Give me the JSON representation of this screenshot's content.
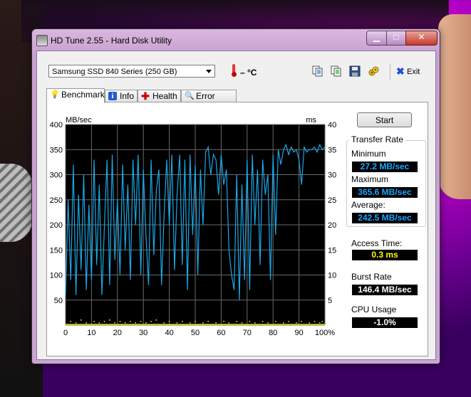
{
  "window": {
    "title": "HD Tune 2.55 - Hard Disk Utility"
  },
  "toolbar": {
    "drive": "Samsung SSD 840 Series (250 GB)",
    "temperature": "– °C",
    "exit_label": "Exit"
  },
  "tabs": [
    {
      "label": "Benchmark",
      "icon": "lightbulb-icon"
    },
    {
      "label": "Info",
      "icon": "info-icon"
    },
    {
      "label": "Health",
      "icon": "health-plus-icon"
    },
    {
      "label": "Error Scan",
      "icon": "magnifier-icon"
    }
  ],
  "buttons": {
    "start": "Start"
  },
  "stats": {
    "transfer_rate_title": "Transfer Rate",
    "minimum_label": "Minimum",
    "minimum_value": "27.2 MB/sec",
    "maximum_label": "Maximum",
    "maximum_value": "365.6 MB/sec",
    "average_label": "Average:",
    "average_value": "242.5 MB/sec",
    "access_time_label": "Access Time:",
    "access_time_value": "0.3 ms",
    "burst_rate_label": "Burst Rate",
    "burst_rate_value": "146.4 MB/sec",
    "cpu_usage_label": "CPU Usage",
    "cpu_usage_value": "-1.0%"
  },
  "colors": {
    "transfer_line": "#1aa7e6",
    "access_dots": "#e8e800",
    "value_blue": "#1aa7ff",
    "value_yellow": "#ffff00",
    "value_white": "#ffffff"
  },
  "chart_data": {
    "type": "line",
    "ylabel_left": "MB/sec",
    "ylabel_right": "ms",
    "yticks_left": [
      400,
      350,
      300,
      250,
      200,
      150,
      100,
      50
    ],
    "yticks_right": [
      40,
      35,
      30,
      25,
      20,
      15,
      10,
      5
    ],
    "xticks": [
      "0",
      "10",
      "20",
      "30",
      "40",
      "50",
      "60",
      "70",
      "80",
      "90",
      "100%"
    ],
    "ylim": [
      0,
      400
    ],
    "xlim": [
      0,
      100
    ],
    "grid": true,
    "series": [
      {
        "values": [
          [
            0,
            60
          ],
          [
            1,
            250
          ],
          [
            2,
            90
          ],
          [
            3,
            320
          ],
          [
            4,
            60
          ],
          [
            5,
            260
          ],
          [
            6,
            110
          ],
          [
            7,
            300
          ],
          [
            8,
            70
          ],
          [
            9,
            240
          ],
          [
            10,
            90
          ],
          [
            11,
            330
          ],
          [
            12,
            120
          ],
          [
            13,
            280
          ],
          [
            14,
            60
          ],
          [
            15,
            200
          ],
          [
            16,
            330
          ],
          [
            17,
            80
          ],
          [
            18,
            340
          ],
          [
            19,
            130
          ],
          [
            20,
            250
          ],
          [
            21,
            100
          ],
          [
            22,
            320
          ],
          [
            23,
            150
          ],
          [
            24,
            280
          ],
          [
            25,
            90
          ],
          [
            26,
            330
          ],
          [
            27,
            200
          ],
          [
            28,
            340
          ],
          [
            29,
            100
          ],
          [
            30,
            310
          ],
          [
            31,
            180
          ],
          [
            32,
            80
          ],
          [
            33,
            330
          ],
          [
            34,
            140
          ],
          [
            35,
            270
          ],
          [
            36,
            310
          ],
          [
            37,
            80
          ],
          [
            38,
            220
          ],
          [
            39,
            330
          ],
          [
            40,
            200
          ],
          [
            41,
            340
          ],
          [
            42,
            110
          ],
          [
            43,
            260
          ],
          [
            44,
            340
          ],
          [
            45,
            120
          ],
          [
            46,
            330
          ],
          [
            47,
            70
          ],
          [
            48,
            340
          ],
          [
            49,
            180
          ],
          [
            50,
            320
          ],
          [
            51,
            100
          ],
          [
            52,
            310
          ],
          [
            53,
            200
          ],
          [
            54,
            345
          ],
          [
            55,
            355
          ],
          [
            56,
            300
          ],
          [
            57,
            340
          ],
          [
            58,
            330
          ],
          [
            59,
            260
          ],
          [
            60,
            340
          ],
          [
            61,
            280
          ],
          [
            62,
            310
          ],
          [
            63,
            150
          ],
          [
            64,
            100
          ],
          [
            65,
            70
          ],
          [
            66,
            300
          ],
          [
            67,
            50
          ],
          [
            68,
            280
          ],
          [
            69,
            90
          ],
          [
            70,
            330
          ],
          [
            71,
            70
          ],
          [
            72,
            340
          ],
          [
            73,
            200
          ],
          [
            74,
            310
          ],
          [
            75,
            120
          ],
          [
            76,
            330
          ],
          [
            77,
            260
          ],
          [
            78,
            300
          ],
          [
            79,
            90
          ],
          [
            80,
            340
          ],
          [
            81,
            180
          ],
          [
            82,
            350
          ],
          [
            83,
            320
          ],
          [
            84,
            350
          ],
          [
            85,
            360
          ],
          [
            86,
            340
          ],
          [
            87,
            355
          ],
          [
            88,
            345
          ],
          [
            89,
            350
          ],
          [
            90,
            330
          ],
          [
            91,
            280
          ],
          [
            92,
            355
          ],
          [
            93,
            345
          ],
          [
            94,
            350
          ],
          [
            95,
            350
          ],
          [
            96,
            355
          ],
          [
            97,
            345
          ],
          [
            98,
            360
          ],
          [
            99,
            350
          ],
          [
            100,
            355
          ]
        ]
      }
    ],
    "access_points": [
      [
        2,
        2
      ],
      [
        4,
        1
      ],
      [
        6,
        3
      ],
      [
        8,
        1
      ],
      [
        11,
        2
      ],
      [
        13,
        1
      ],
      [
        15,
        2
      ],
      [
        17,
        3
      ],
      [
        19,
        1
      ],
      [
        21,
        2
      ],
      [
        23,
        1
      ],
      [
        25,
        2
      ],
      [
        27,
        1
      ],
      [
        29,
        2
      ],
      [
        31,
        1
      ],
      [
        33,
        2
      ],
      [
        35,
        3
      ],
      [
        38,
        1
      ],
      [
        40,
        2
      ],
      [
        43,
        1
      ],
      [
        45,
        2
      ],
      [
        48,
        1
      ],
      [
        50,
        2
      ],
      [
        53,
        1
      ],
      [
        55,
        2
      ],
      [
        58,
        1
      ],
      [
        61,
        2
      ],
      [
        63,
        1
      ],
      [
        66,
        2
      ],
      [
        68,
        1
      ],
      [
        71,
        2
      ],
      [
        73,
        1
      ],
      [
        76,
        2
      ],
      [
        78,
        1
      ],
      [
        81,
        2
      ],
      [
        84,
        1
      ],
      [
        86,
        2
      ],
      [
        89,
        1
      ],
      [
        91,
        2
      ],
      [
        94,
        1
      ],
      [
        96,
        2
      ],
      [
        98,
        1
      ],
      [
        99,
        2
      ]
    ]
  }
}
